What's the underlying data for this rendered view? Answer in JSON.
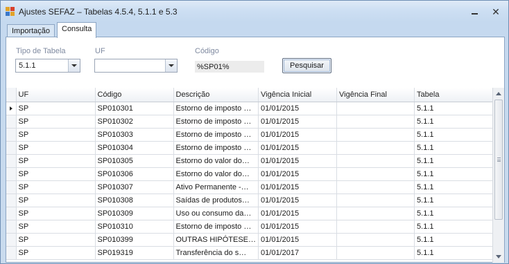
{
  "window": {
    "title": "Ajustes SEFAZ – Tabelas 4.5.4, 5.1.1 e 5.3"
  },
  "tabs": [
    {
      "label": "Importação"
    },
    {
      "label": "Consulta"
    }
  ],
  "filters": {
    "tipo_label": "Tipo de Tabela",
    "tipo_value": "5.1.1",
    "uf_label": "UF",
    "uf_value": "",
    "codigo_label": "Código",
    "codigo_value": "%SP01%",
    "search_label": "Pesquisar"
  },
  "grid": {
    "columns": [
      "UF",
      "Código",
      "Descrição",
      "Vigência Inicial",
      "Vigência Final",
      "Tabela"
    ],
    "rows": [
      [
        "SP",
        "SP010301",
        "Estorno de imposto …",
        "01/01/2015",
        "",
        "5.1.1"
      ],
      [
        "SP",
        "SP010302",
        "Estorno de imposto …",
        "01/01/2015",
        "",
        "5.1.1"
      ],
      [
        "SP",
        "SP010303",
        "Estorno de imposto …",
        "01/01/2015",
        "",
        "5.1.1"
      ],
      [
        "SP",
        "SP010304",
        "Estorno de imposto …",
        "01/01/2015",
        "",
        "5.1.1"
      ],
      [
        "SP",
        "SP010305",
        "Estorno do valor do…",
        "01/01/2015",
        "",
        "5.1.1"
      ],
      [
        "SP",
        "SP010306",
        "Estorno do valor do…",
        "01/01/2015",
        "",
        "5.1.1"
      ],
      [
        "SP",
        "SP010307",
        "Ativo Permanente -…",
        "01/01/2015",
        "",
        "5.1.1"
      ],
      [
        "SP",
        "SP010308",
        "Saídas de produtos…",
        "01/01/2015",
        "",
        "5.1.1"
      ],
      [
        "SP",
        "SP010309",
        "Uso ou consumo da…",
        "01/01/2015",
        "",
        "5.1.1"
      ],
      [
        "SP",
        "SP010310",
        "Estorno de imposto …",
        "01/01/2015",
        "",
        "5.1.1"
      ],
      [
        "SP",
        "SP010399",
        "OUTRAS HIPÓTESE…",
        "01/01/2015",
        "",
        "5.1.1"
      ],
      [
        "SP",
        "SP019319",
        "Transferência do s…",
        "01/01/2017",
        "",
        "5.1.1"
      ]
    ]
  },
  "colors": {
    "window_bg": "#c9dbee",
    "header_bg": "#eef1f5",
    "border": "#8ca5c3"
  },
  "icons": {
    "app": "app-icon",
    "minimize": "minimize-icon",
    "close": "close-icon",
    "row_indicator": "current-row-arrow-icon"
  }
}
